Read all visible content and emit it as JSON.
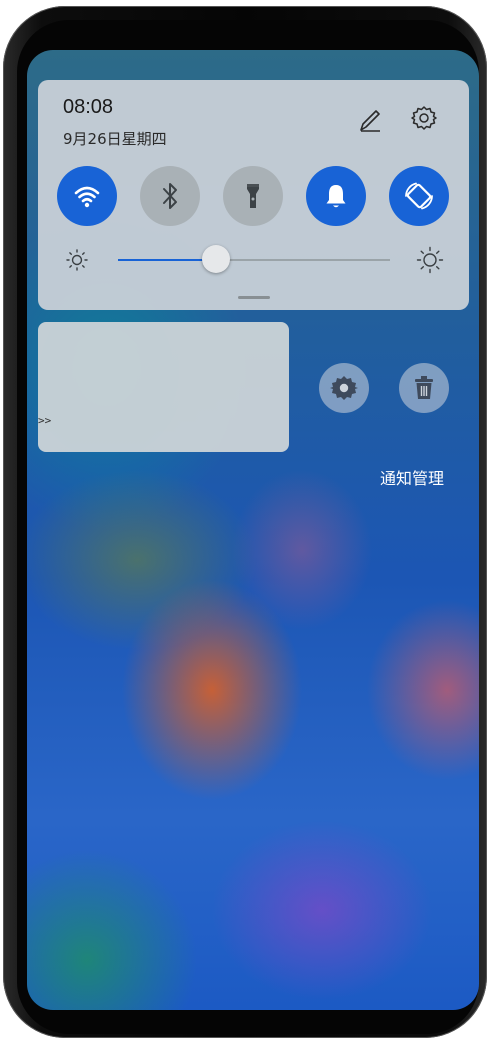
{
  "status": {
    "time": "08:08",
    "date": "9月26日星期四"
  },
  "quick_settings": {
    "toggles": [
      {
        "name": "wifi",
        "icon": "wifi-icon",
        "state": "on"
      },
      {
        "name": "bluetooth",
        "icon": "bluetooth-icon",
        "state": "off"
      },
      {
        "name": "flashlight",
        "icon": "flashlight-icon",
        "state": "off"
      },
      {
        "name": "sound",
        "icon": "bell-icon",
        "state": "on"
      },
      {
        "name": "auto-rotate",
        "icon": "rotate-icon",
        "state": "on"
      }
    ],
    "brightness": 0.36,
    "accent_color": "#1863d6",
    "off_color": "#a9b1b6"
  },
  "notification": {
    "text": ">>"
  },
  "notification_actions": {
    "settings_icon": "gear-icon",
    "delete_icon": "trash-icon",
    "manage_label": "通知管理"
  }
}
